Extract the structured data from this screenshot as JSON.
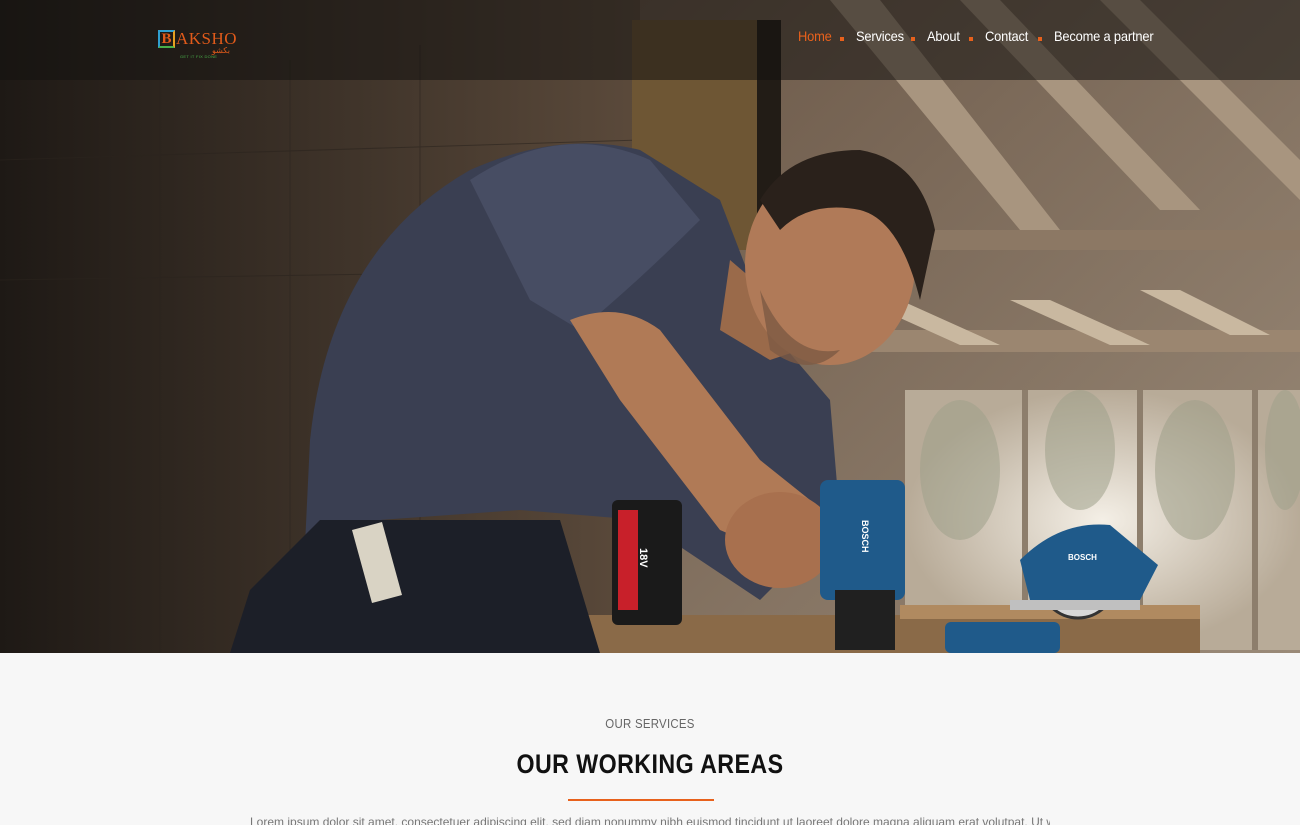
{
  "brand": {
    "logo_letter": "B",
    "logo_word": "AKSHO",
    "logo_arabic": "بكشو",
    "tagline": "GET IT FIX DONE"
  },
  "nav": {
    "items": [
      {
        "label": "Home",
        "active": true
      },
      {
        "label": "Services",
        "active": false
      },
      {
        "label": "About",
        "active": false
      },
      {
        "label": "Contact",
        "active": false
      },
      {
        "label": "Become a partner",
        "active": false
      }
    ]
  },
  "hero": {
    "drill_battery_label": "18V",
    "drill_brand": "BOSCH",
    "saw_brand": "BOSCH"
  },
  "services": {
    "eyebrow": "OUR SERVICES",
    "title": "OUR WORKING AREAS",
    "intro": "Lorem ipsum dolor sit amet, consectetuer adipiscing elit, sed diam nonummy nibh euismod tincidunt ut laoreet dolore magna aliquam erat volutpat. Ut wisi enim ad"
  },
  "colors": {
    "accent": "#e8611c",
    "nav_text": "#ffffff",
    "section_bg": "#f7f7f7"
  }
}
